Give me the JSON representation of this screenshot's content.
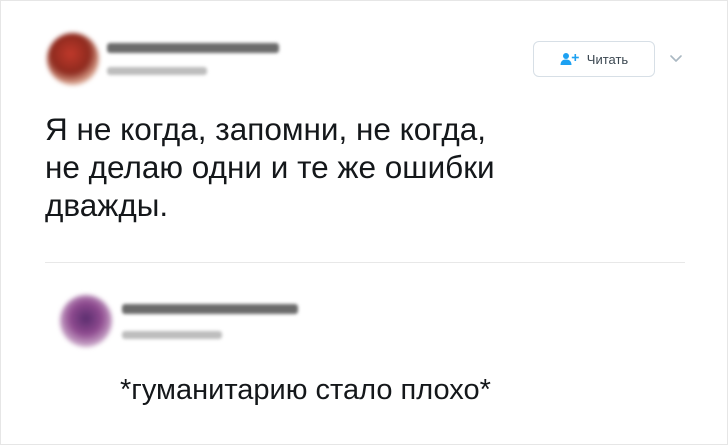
{
  "tweet": {
    "follow_button": {
      "label": "Читать",
      "icon": "add-user-icon"
    },
    "more_icon": "chevron-down-icon",
    "text_lines": [
      "Я не когда, запомни, не когда,",
      "не делаю одни и те же ошибки",
      "дважды."
    ]
  },
  "reply": {
    "text": "*гуманитарию стало плохо*"
  },
  "colors": {
    "text": "#14171a",
    "accent": "#1da1f2",
    "divider": "#e8e8e8"
  }
}
